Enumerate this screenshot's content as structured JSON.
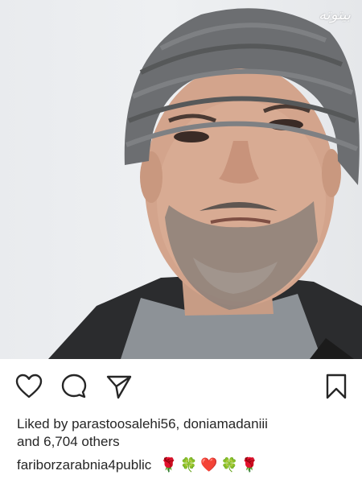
{
  "watermark": "بیتوته",
  "post": {
    "photo_alt": "Man wearing a grey knit beanie",
    "likes": {
      "prefix": "Liked by",
      "user1": "parastoosalehi56",
      "separator": ",",
      "user2": "doniamadaniii",
      "conjunction": "and",
      "others": "6,704 others"
    },
    "caption": {
      "username": "fariborzarabnia4public",
      "text": "🌹🍀❤️🍀🌹"
    }
  },
  "icons": {
    "like": "heart-icon",
    "comment": "comment-bubble-icon",
    "share": "paper-plane-icon",
    "save": "bookmark-icon"
  }
}
